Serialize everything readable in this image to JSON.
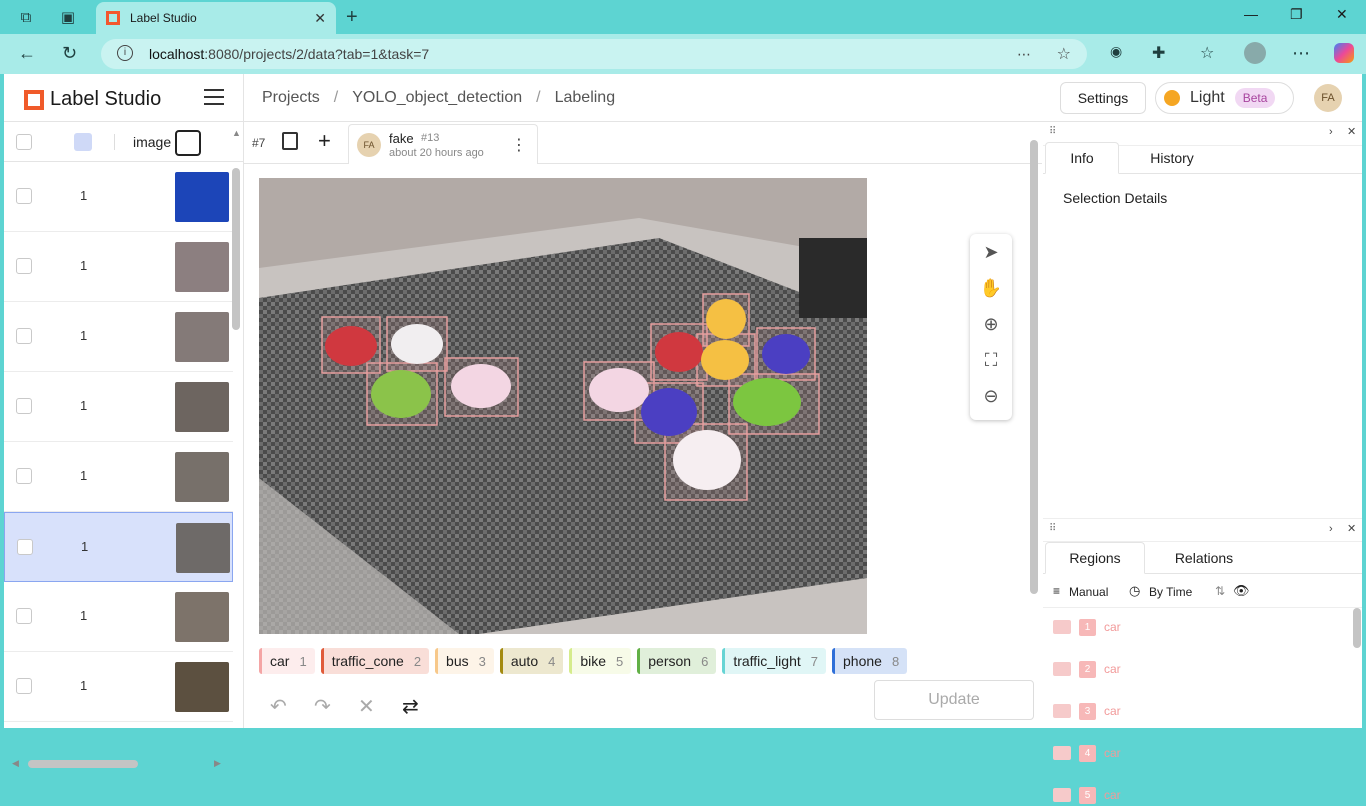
{
  "browser": {
    "tab_title": "Label Studio",
    "url_host": "localhost",
    "url_path": ":8080/projects/2/data?tab=1&task=7"
  },
  "app": {
    "logo_text": "Label Studio",
    "breadcrumbs": [
      "Projects",
      "YOLO_object_detection",
      "Labeling"
    ],
    "settings_label": "Settings",
    "theme_label": "Light",
    "beta_label": "Beta",
    "avatar_initials": "FA"
  },
  "list": {
    "column_image": "image",
    "rows": [
      {
        "value": "1"
      },
      {
        "value": "1"
      },
      {
        "value": "1"
      },
      {
        "value": "1"
      },
      {
        "value": "1"
      },
      {
        "value": "1"
      },
      {
        "value": "1"
      },
      {
        "value": "1"
      }
    ],
    "selected_row": 5
  },
  "task": {
    "number": "#7",
    "annotator": "fake",
    "annotation_id": "#13",
    "time_ago": "about 20 hours ago",
    "avatar_initials": "FA"
  },
  "labels": [
    {
      "name": "car",
      "key": "1",
      "color": "#f4a5a5"
    },
    {
      "name": "traffic_cone",
      "key": "2",
      "color": "#e05b3a"
    },
    {
      "name": "bus",
      "key": "3",
      "color": "#f7c88a"
    },
    {
      "name": "auto",
      "key": "4",
      "color": "#a38a10"
    },
    {
      "name": "bike",
      "key": "5",
      "color": "#d5ec8c"
    },
    {
      "name": "person",
      "key": "6",
      "color": "#62b046"
    },
    {
      "name": "traffic_light",
      "key": "7",
      "color": "#66d4d4"
    },
    {
      "name": "phone",
      "key": "8",
      "color": "#2f6fd8"
    }
  ],
  "update_label": "Update",
  "info_panel": {
    "tabs": [
      "Info",
      "History"
    ],
    "selection_title": "Selection Details"
  },
  "regions_panel": {
    "tabs": [
      "Regions",
      "Relations"
    ],
    "manual_label": "Manual",
    "sort_label": "By Time",
    "items": [
      {
        "index": "1",
        "label": "car"
      },
      {
        "index": "2",
        "label": "car"
      },
      {
        "index": "3",
        "label": "car"
      },
      {
        "index": "4",
        "label": "car"
      },
      {
        "index": "5",
        "label": "car"
      }
    ]
  }
}
